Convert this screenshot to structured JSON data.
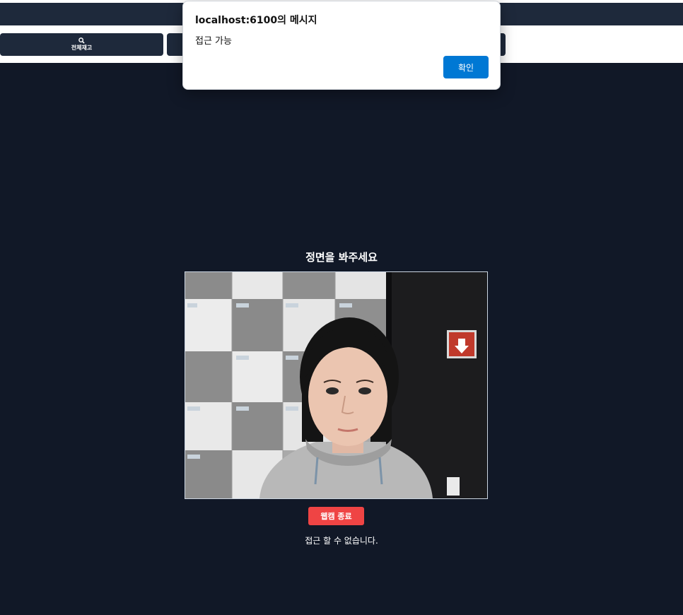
{
  "nav": {
    "items": [
      {
        "label": "전체재고",
        "icon": "search-icon"
      }
    ]
  },
  "main": {
    "title": "정면을 봐주세요",
    "webcam_stop_label": "웹캠 종료",
    "status_text": "접근 할 수 없습니다."
  },
  "dialog": {
    "title": "localhost:6100의 메시지",
    "message": "접근 가능",
    "ok_label": "확인"
  },
  "colors": {
    "background": "#111827",
    "nav_button": "#1e293b",
    "stop_button": "#ef4444",
    "dialog_ok": "#0078d4"
  }
}
